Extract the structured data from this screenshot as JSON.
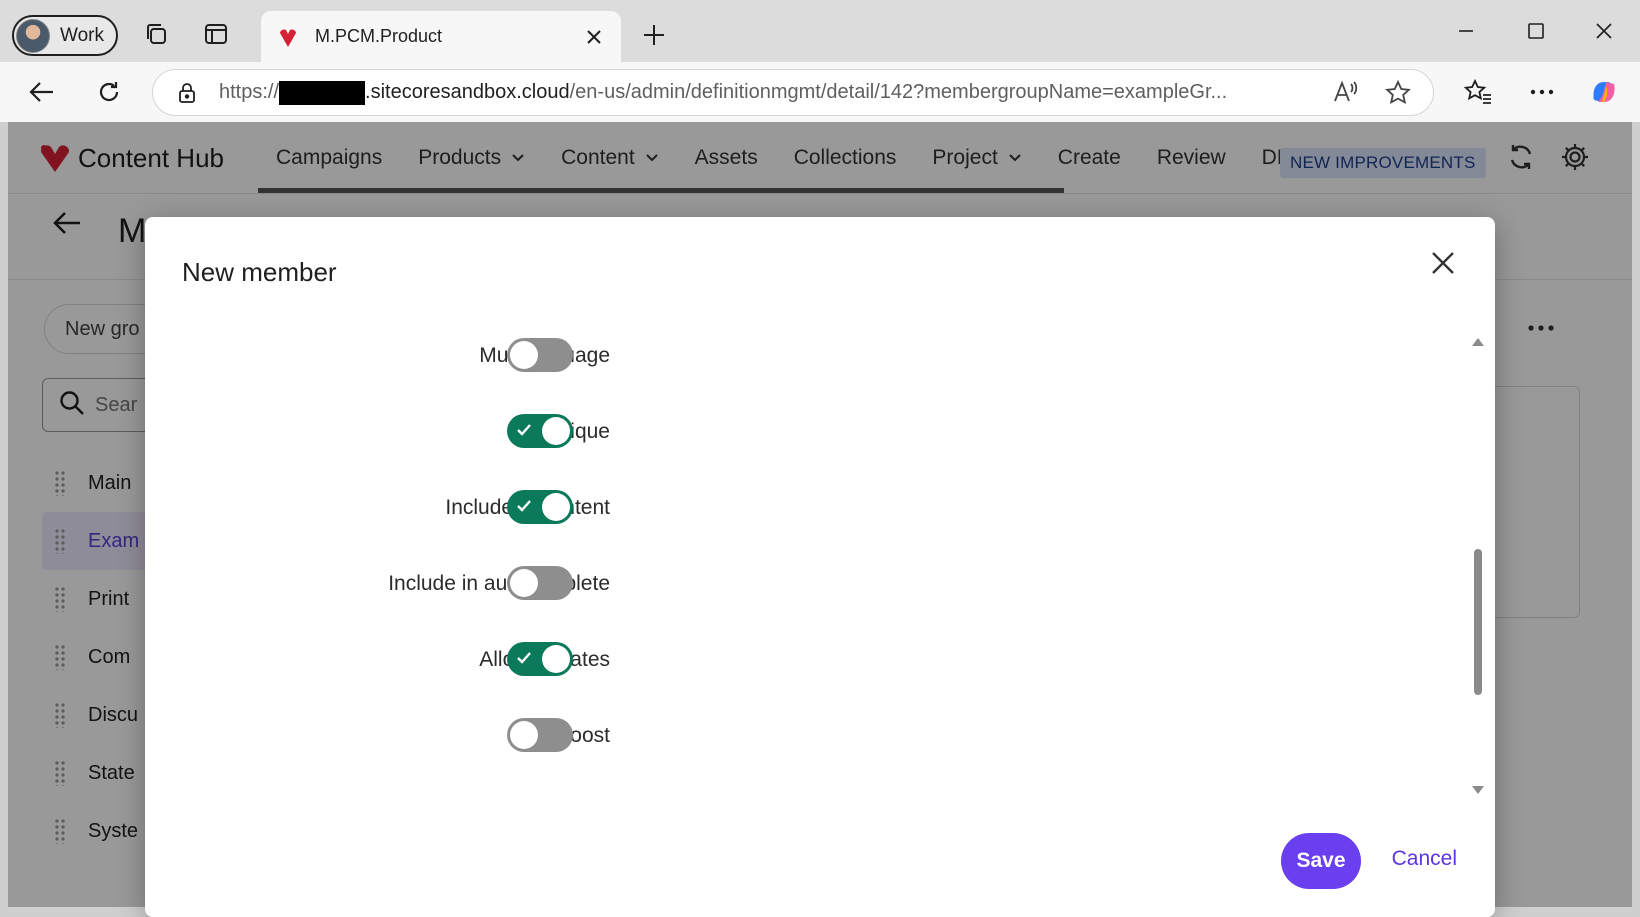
{
  "browser": {
    "profile_label": "Work",
    "tab_title": "M.PCM.Product",
    "url_prefix": "https://",
    "url_host": ".sitecoresandbox.cloud",
    "url_path": "/en-us/admin/definitionmgmt/detail/142?membergroupName=exampleGr..."
  },
  "app": {
    "brand": "Content Hub",
    "nav": [
      {
        "label": "Campaigns",
        "dropdown": false
      },
      {
        "label": "Products",
        "dropdown": true
      },
      {
        "label": "Content",
        "dropdown": true
      },
      {
        "label": "Assets",
        "dropdown": false
      },
      {
        "label": "Collections",
        "dropdown": false
      },
      {
        "label": "Project",
        "dropdown": true
      },
      {
        "label": "Create",
        "dropdown": false
      },
      {
        "label": "Review",
        "dropdown": false
      },
      {
        "label": "DR",
        "dropdown": false
      }
    ],
    "badge": "NEW IMPROVEMENTS",
    "page_title": "M",
    "new_group_label": "New gro",
    "search_placeholder": "Sear",
    "sidebar_items": [
      {
        "label": "Main",
        "active": false
      },
      {
        "label": "Exam",
        "active": true
      },
      {
        "label": "Print",
        "active": false
      },
      {
        "label": "Com",
        "active": false
      },
      {
        "label": "Discu",
        "active": false
      },
      {
        "label": "State",
        "active": false
      },
      {
        "label": "Syste",
        "active": false
      }
    ]
  },
  "modal": {
    "title": "New member",
    "fields": [
      {
        "label": "Multilanguage",
        "checked": false
      },
      {
        "label": "Unique",
        "checked": true
      },
      {
        "label": "Include in content",
        "checked": true
      },
      {
        "label": "Include in autocomplete",
        "checked": false
      },
      {
        "label": "Allow updates",
        "checked": true
      },
      {
        "label": "Boost",
        "checked": false
      }
    ],
    "save_label": "Save",
    "cancel_label": "Cancel"
  },
  "colors": {
    "toggle_on": "#0a7a5a",
    "toggle_off": "#8e8e8e",
    "primary": "#6a3ff0",
    "brand_red": "#d62035"
  }
}
